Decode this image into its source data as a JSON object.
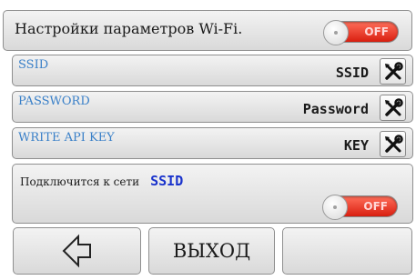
{
  "header": {
    "title": "Настройки параметров Wi-Fi.",
    "toggle_label": "OFF"
  },
  "fields": {
    "ssid": {
      "label": "SSID",
      "value": "SSID"
    },
    "password": {
      "label": "PASSWORD",
      "value": "Password"
    },
    "key": {
      "label": "WRITE API KEY",
      "value": "KEY"
    }
  },
  "connect": {
    "text": "Подключится к сети",
    "network": "SSID",
    "toggle_label": "OFF"
  },
  "footer": {
    "back_icon": "arrow-left-icon",
    "exit_label": "ВЫХОД"
  },
  "colors": {
    "toggle_off": "#e0321f",
    "label_blue": "#3a80c8",
    "network_blue": "#1a33cc"
  }
}
